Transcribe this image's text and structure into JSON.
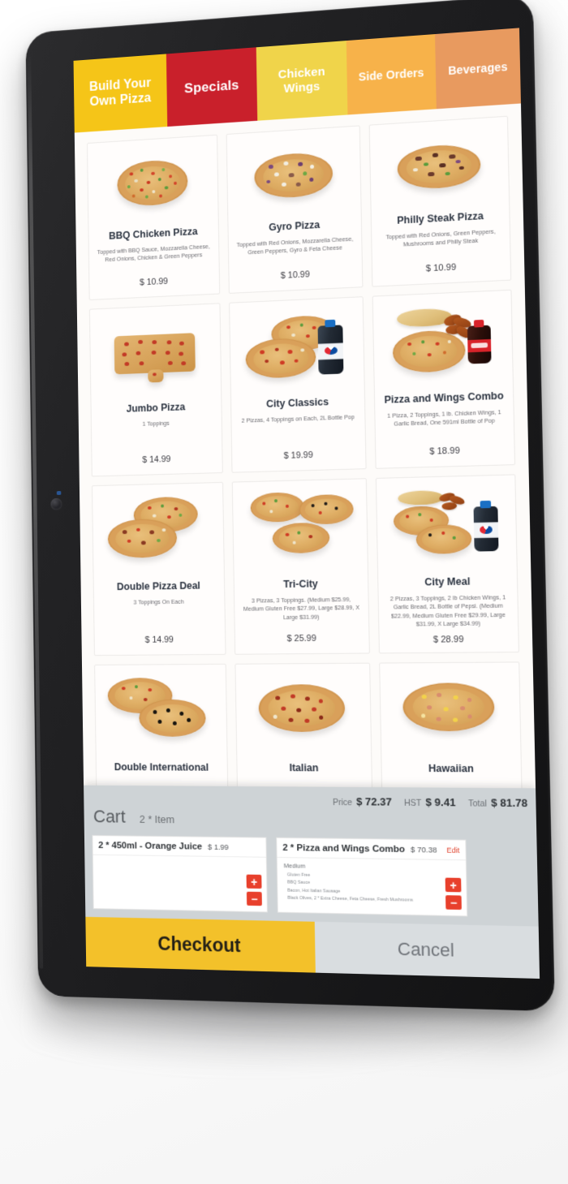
{
  "tabs": [
    {
      "label": "Build Your Own Pizza",
      "color": "#f5c518",
      "active": false
    },
    {
      "label": "Specials",
      "color": "#c9202b",
      "active": true
    },
    {
      "label": "Chicken Wings",
      "color": "#f0d44a",
      "active": false
    },
    {
      "label": "Side Orders",
      "color": "#f7b24a",
      "active": false
    },
    {
      "label": "Beverages",
      "color": "#e89a5f",
      "active": false
    }
  ],
  "menu": {
    "rows": [
      [
        {
          "name": "BBQ Chicken Pizza",
          "desc": "Topped with BBQ Sauce, Mozzarella Cheese, Red Onions, Chicken & Green Peppers",
          "price": "$ 10.99"
        },
        {
          "name": "Gyro Pizza",
          "desc": "Topped with Red Onions, Mozzarella Cheese, Green Peppers, Gyro & Feta Cheese",
          "price": "$ 10.99"
        },
        {
          "name": "Philly Steak Pizza",
          "desc": "Topped with Red Onions, Green Peppers, Mushrooms and Philly Steak",
          "price": "$ 10.99"
        }
      ],
      [
        {
          "name": "Jumbo Pizza",
          "desc": "1 Toppings",
          "price": "$ 14.99"
        },
        {
          "name": "City Classics",
          "desc": "2 Pizzas, 4 Toppings on Each, 2L Bottle Pop",
          "price": "$ 19.99"
        },
        {
          "name": "Pizza and Wings Combo",
          "desc": "1 Pizza, 2 Toppings, 1 lb. Chicken Wings, 1 Garlic Bread, One 591ml Bottle of Pop",
          "price": "$ 18.99"
        }
      ],
      [
        {
          "name": "Double Pizza Deal",
          "desc": "3 Toppings On Each",
          "price": "$ 14.99"
        },
        {
          "name": "Tri-City",
          "desc": "3 Pizzas, 3 Toppings. (Medium $25.99, Medium Gluten Free $27.99, Large $28.99, X Large $31.99)",
          "price": "$ 25.99"
        },
        {
          "name": "City Meal",
          "desc": "2 Pizzas, 3 Toppings, 2 lb Chicken Wings, 1 Garlic Bread, 2L Bottle of Pepsi. (Medium $22.99, Medium Gluten Free $29.99, Large $31.99, X Large $34.99)",
          "price": "$ 28.99"
        }
      ],
      [
        {
          "name": "Double International",
          "desc": "",
          "price": ""
        },
        {
          "name": "Italian",
          "desc": "",
          "price": ""
        },
        {
          "name": "Hawaiian",
          "desc": "",
          "price": ""
        }
      ]
    ]
  },
  "cart": {
    "title": "Cart",
    "count": "2 * Item",
    "totals": [
      {
        "label": "Price",
        "value": "$ 72.37"
      },
      {
        "label": "HST",
        "value": "$ 9.41"
      },
      {
        "label": "Total",
        "value": "$ 81.78"
      }
    ],
    "items": [
      {
        "name": "2 * 450ml - Orange Juice",
        "price": "$ 1.99",
        "size": "",
        "edit_label": "",
        "options": []
      },
      {
        "name": "2 * Pizza and Wings Combo",
        "price": "$ 70.38",
        "size": "Medium",
        "edit_label": "Edit",
        "options": [
          "Gluten Free",
          "BBQ Sauce",
          "Bacon,  Hot Italian Sausage",
          "Black Olives,  2 * Extra Cheese,  Feta Cheese,  Fresh Mushrooms"
        ]
      }
    ],
    "qty_increase": "+",
    "qty_decrease": "−"
  },
  "actions": {
    "checkout_label": "Checkout",
    "cancel_label": "Cancel"
  },
  "colors": {
    "brand_yellow": "#f5c518",
    "brand_red": "#c9202b",
    "accent_orange": "#e89a5f",
    "qty_red": "#e8402c",
    "checkout_yellow": "#f3c12a",
    "cart_gray": "#ced3d6"
  }
}
